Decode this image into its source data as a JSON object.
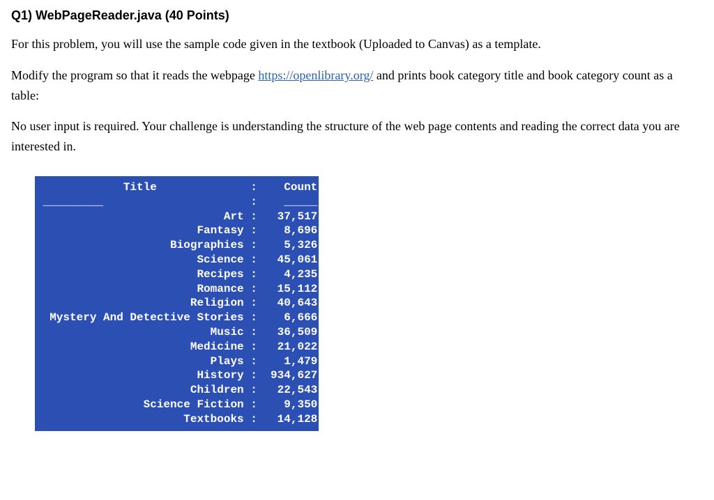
{
  "heading": "Q1) WebPageReader.java (40 Points)",
  "para1": "For this problem, you will use the sample code given in the textbook (Uploaded to Canvas) as a template.",
  "para2a": "Modify the program so that it reads the webpage ",
  "para2link": "https://openlibrary.org/",
  "para2b": " and prints book category title and book category count as a table:",
  "para3": "No user input is required. Your challenge is understanding the structure of the web page contents and reading the correct data you are interested in.",
  "console": {
    "header_title": "Title",
    "header_count": "Count",
    "rows": [
      {
        "title": "Art",
        "count": "37,517"
      },
      {
        "title": "Fantasy",
        "count": "8,696"
      },
      {
        "title": "Biographies",
        "count": "5,326"
      },
      {
        "title": "Science",
        "count": "45,061"
      },
      {
        "title": "Recipes",
        "count": "4,235"
      },
      {
        "title": "Romance",
        "count": "15,112"
      },
      {
        "title": "Religion",
        "count": "40,643"
      },
      {
        "title": "Mystery And Detective Stories",
        "count": "6,666"
      },
      {
        "title": "Music",
        "count": "36,509"
      },
      {
        "title": "Medicine",
        "count": "21,022"
      },
      {
        "title": "Plays",
        "count": "1,479"
      },
      {
        "title": "History",
        "count": "934,627"
      },
      {
        "title": "Children",
        "count": "22,543"
      },
      {
        "title": "Science Fiction",
        "count": "9,350"
      },
      {
        "title": "Textbooks",
        "count": "14,128"
      }
    ],
    "title_col_width": 31,
    "count_col_width": 8
  },
  "chart_data": {
    "type": "table",
    "title": "Book Category Counts",
    "columns": [
      "Title",
      "Count"
    ],
    "rows": [
      [
        "Art",
        37517
      ],
      [
        "Fantasy",
        8696
      ],
      [
        "Biographies",
        5326
      ],
      [
        "Science",
        45061
      ],
      [
        "Recipes",
        4235
      ],
      [
        "Romance",
        15112
      ],
      [
        "Religion",
        40643
      ],
      [
        "Mystery And Detective Stories",
        6666
      ],
      [
        "Music",
        36509
      ],
      [
        "Medicine",
        21022
      ],
      [
        "Plays",
        1479
      ],
      [
        "History",
        934627
      ],
      [
        "Children",
        22543
      ],
      [
        "Science Fiction",
        9350
      ],
      [
        "Textbooks",
        14128
      ]
    ]
  }
}
